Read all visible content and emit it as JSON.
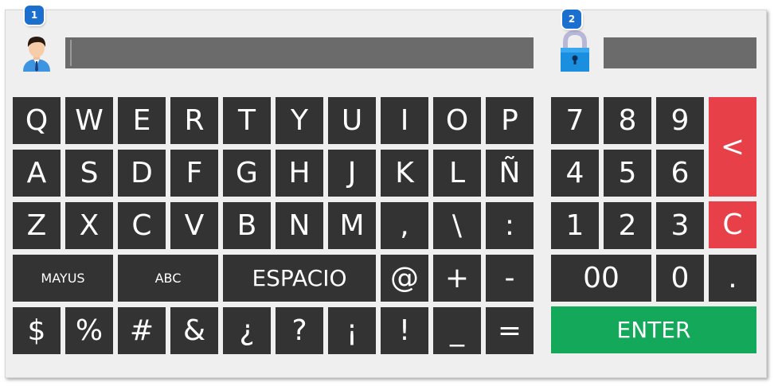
{
  "badges": {
    "user": "1",
    "password": "2"
  },
  "user_field": {
    "value": ""
  },
  "password_field": {
    "value": ""
  },
  "alpha_keys": [
    [
      "Q",
      "W",
      "E",
      "R",
      "T",
      "Y",
      "U",
      "I",
      "O",
      "P"
    ],
    [
      "A",
      "S",
      "D",
      "F",
      "G",
      "H",
      "J",
      "K",
      "L",
      "Ñ"
    ],
    [
      "Z",
      "X",
      "C",
      "V",
      "B",
      "N",
      "M",
      ",",
      "\\",
      ":"
    ],
    [
      "MAYUS",
      "ABC",
      "ESPACIO",
      "@",
      "+",
      "-"
    ],
    [
      "$",
      "%",
      "#",
      "&",
      "¿",
      "?",
      "¡",
      "!",
      "_",
      "="
    ]
  ],
  "num_keys": [
    [
      "7",
      "8",
      "9"
    ],
    [
      "4",
      "5",
      "6"
    ],
    [
      "1",
      "2",
      "3"
    ],
    [
      "00",
      "0",
      "."
    ]
  ],
  "backspace_label": "<",
  "clear_label": "C",
  "enter_label": "ENTER",
  "colors": {
    "key": "#333333",
    "red": "#e84049",
    "green": "#14a85a",
    "badge": "#1b6fcf"
  },
  "icons": {
    "user": "user-avatar-icon",
    "password": "lock-icon"
  }
}
